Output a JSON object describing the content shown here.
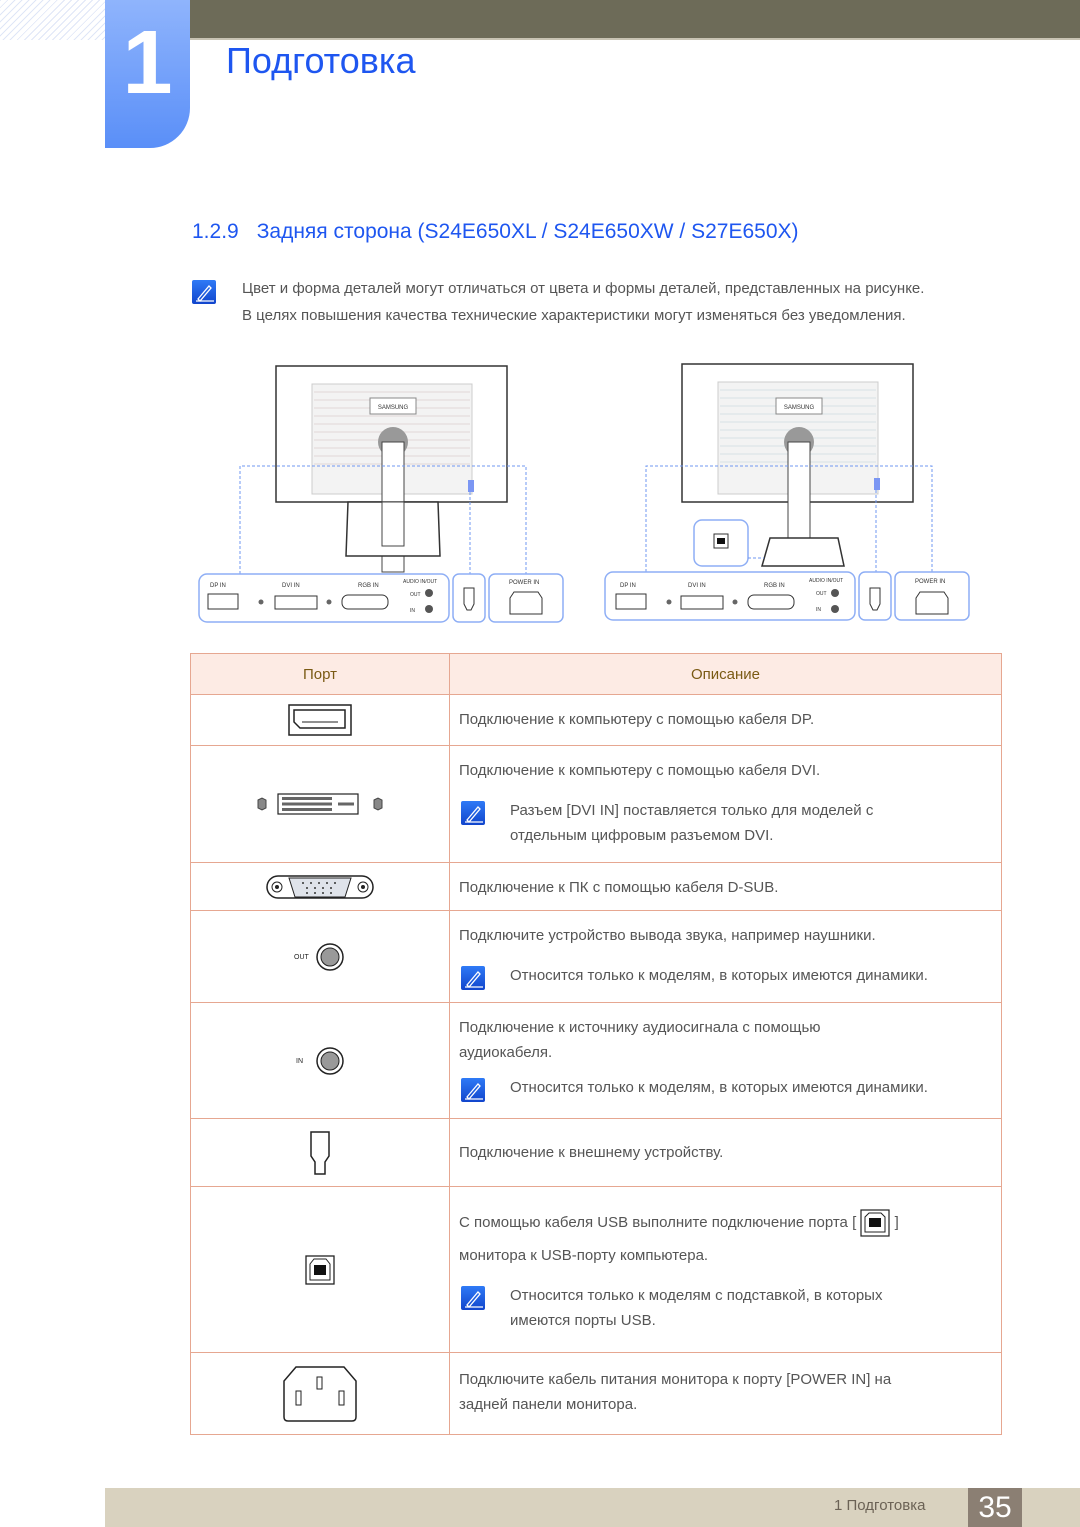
{
  "header": {
    "chapter_number": "1",
    "chapter_title": "Подготовка"
  },
  "section": {
    "number": "1.2.9",
    "title": "Задняя сторона (S24E650XL / S24E650XW / S27E650X)"
  },
  "intro_note": {
    "icon": "note-pencil-icon",
    "lines": [
      "Цвет и форма деталей могут отличаться от цвета и формы деталей, представленных на рисунке.",
      "В целях повышения качества технические характеристики могут изменяться без уведомления."
    ]
  },
  "diagrams": {
    "brand": "SAMSUNG",
    "labels": {
      "dp_in": "DP IN",
      "dvi_in": "DVI IN",
      "rgb_in": "RGB IN",
      "audio": "AUDIO IN/OUT",
      "out": "OUT",
      "in": "IN",
      "power_in": "POWER IN"
    }
  },
  "table": {
    "headers": {
      "port": "Порт",
      "description": "Описание"
    },
    "rows": [
      {
        "port_icon": "displayport-icon",
        "text": [
          "Подключение к компьютеру с помощью кабеля DP."
        ]
      },
      {
        "port_icon": "dvi-port-icon",
        "text": [
          "Подключение к компьютеру с помощью кабеля DVI."
        ],
        "note": [
          "Разъем [DVI IN] поставляется только для моделей с",
          "отдельным цифровым разъемом DVI."
        ]
      },
      {
        "port_icon": "vga-dsub-port-icon",
        "text": [
          "Подключение к ПК с помощью кабеля D-SUB."
        ]
      },
      {
        "port_icon": "audio-out-jack-icon",
        "port_label": "OUT",
        "text": [
          "Подключите устройство вывода звука, например наушники."
        ],
        "note": [
          "Относится только к моделям, в которых имеются динамики."
        ]
      },
      {
        "port_icon": "audio-in-jack-icon",
        "port_label": "IN",
        "text": [
          "Подключение к источнику аудиосигнала с помощью",
          "аудиокабеля."
        ],
        "note": [
          "Относится только к моделям, в которых имеются динамики."
        ]
      },
      {
        "port_icon": "kensington-lock-icon",
        "text": [
          "Подключение к внешнему устройству."
        ]
      },
      {
        "port_icon": "usb-b-port-icon",
        "text_before_icon": "С помощью кабеля USB выполните подключение порта [",
        "text_after_icon": "]",
        "text2": "монитора к USB-порту компьютера.",
        "note": [
          "Относится только к моделям с подставкой, в которых",
          "имеются порты USB."
        ]
      },
      {
        "port_icon": "power-in-port-icon",
        "text": [
          "Подключите кабель питания монитора к порту [POWER IN] на",
          "задней панели монитора."
        ]
      }
    ]
  },
  "footer": {
    "chapter_label": "1 Подготовка",
    "page_number": "35"
  }
}
